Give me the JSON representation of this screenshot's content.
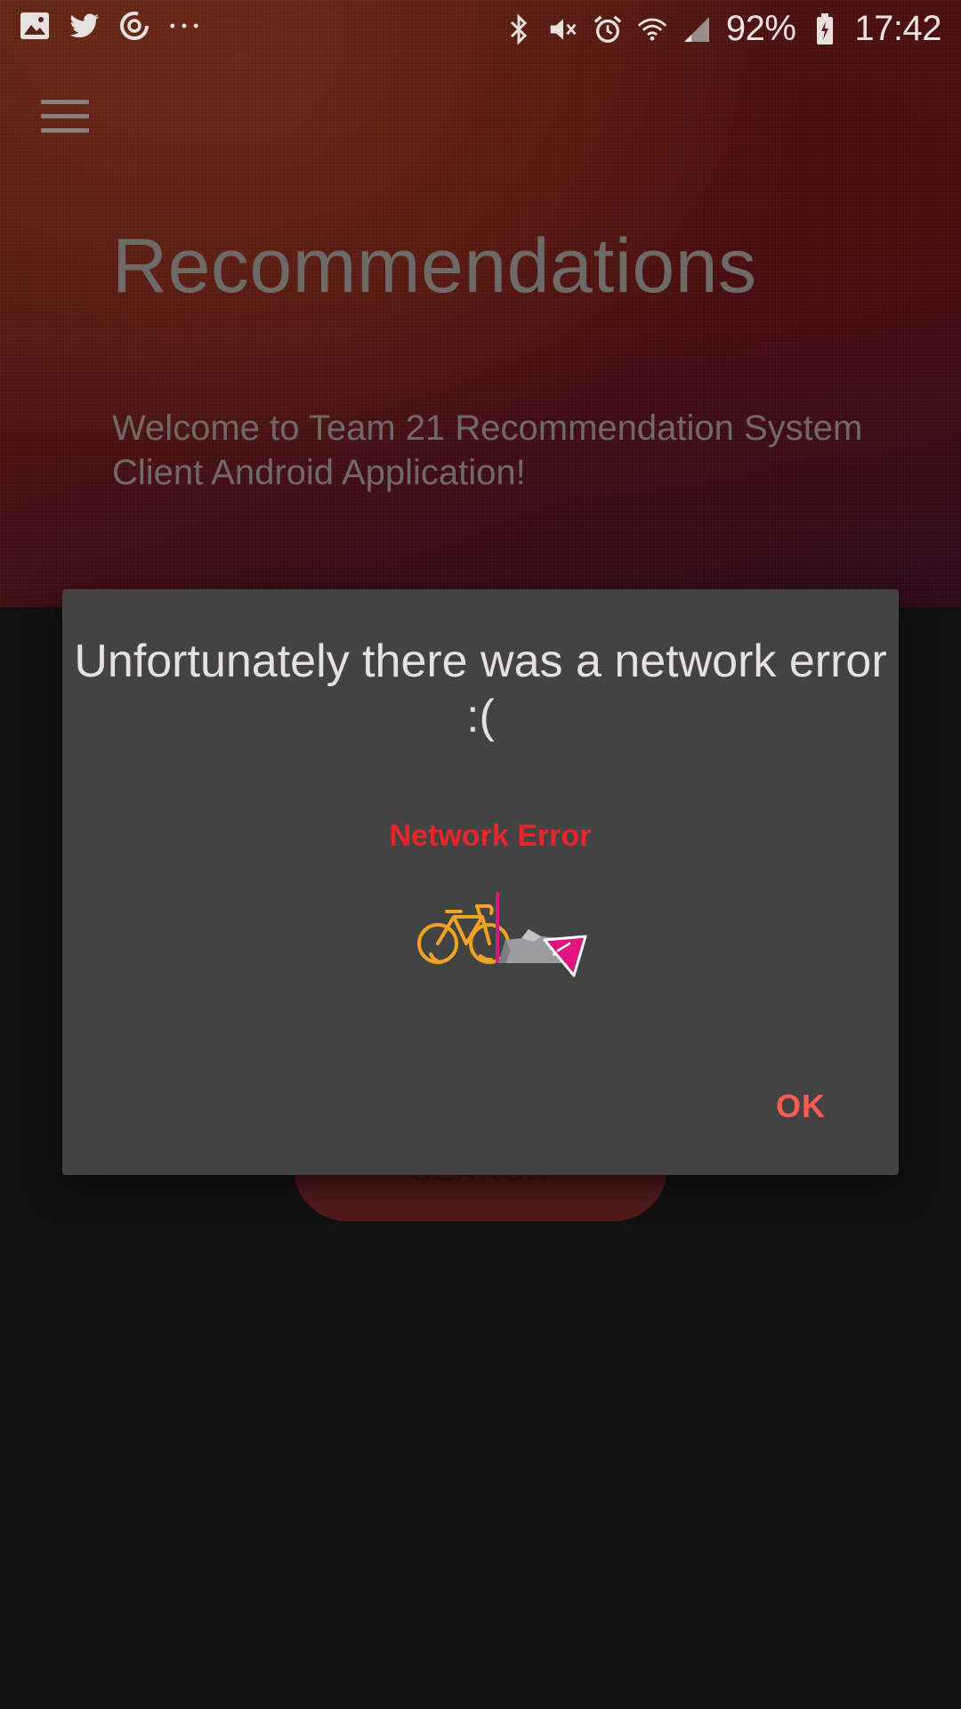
{
  "status_bar": {
    "left_icons": [
      "image-icon",
      "twitter-icon",
      "sync-icon",
      "more-dots-icon"
    ],
    "right_icons": [
      "bluetooth-icon",
      "mute-icon",
      "alarm-icon",
      "wifi-icon",
      "signal-icon",
      "battery-icon"
    ],
    "battery_percent": "92%",
    "time": "17:42"
  },
  "header": {
    "menu_icon": "hamburger-menu-icon",
    "title": "Recommendations",
    "welcome_text": "Welcome to Team 21 Recommendation System Client Android Application!"
  },
  "main": {
    "search_label": "SEARCH"
  },
  "dialog": {
    "title": "Unfortunately there was a network error :(",
    "error_label": "Network Error",
    "ok_label": "OK",
    "illustration_icon": "bicycle-crash-icon"
  },
  "colors": {
    "dialog_background": "#434343",
    "error_red": "#e8262a",
    "ok_accent": "#ff5c54",
    "bike_orange": "#f2a324",
    "flag_magenta": "#e0147f"
  }
}
